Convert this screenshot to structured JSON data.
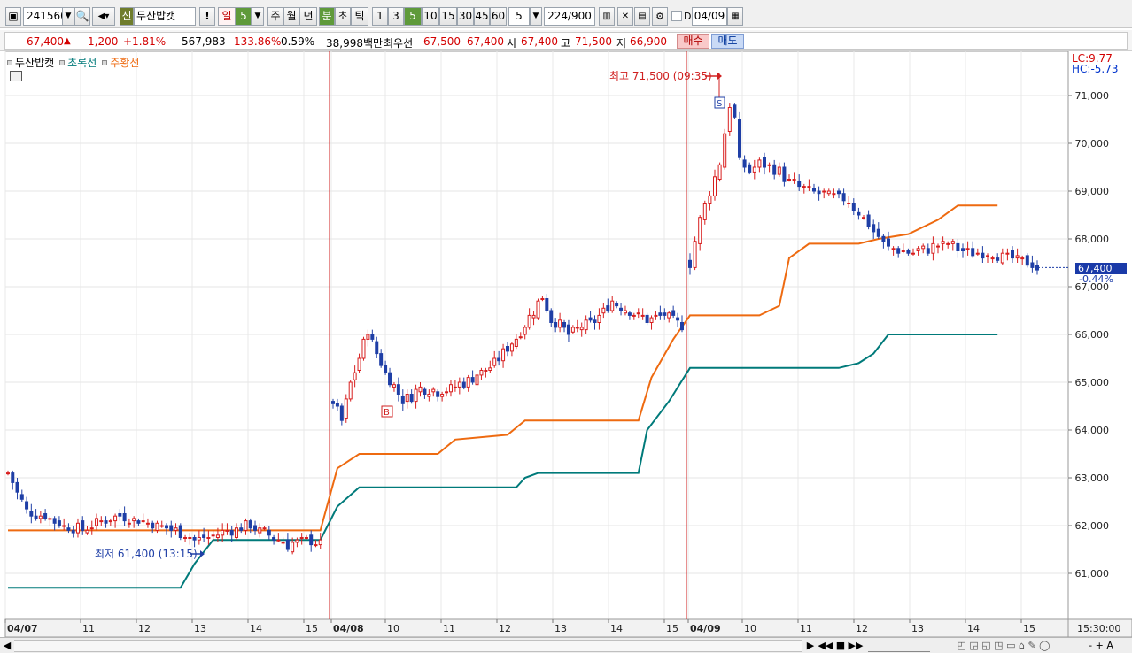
{
  "toolbar": {
    "code": "241560",
    "name": "두산밥캣",
    "credit_badge": "신",
    "alert": "!",
    "period_day": "일",
    "period_day_count": "5",
    "period_week": "주",
    "period_month": "월",
    "period_year": "년",
    "period_minute": "분",
    "period_second": "초",
    "period_tick": "틱",
    "minute_options": [
      "1",
      "3",
      "5",
      "10",
      "15",
      "30",
      "45",
      "60"
    ],
    "minute_selected": "5",
    "custom_interval": "5",
    "data_count": "224",
    "data_max": "/900",
    "d_label": "D",
    "date": "04/09"
  },
  "infobar": {
    "price": "67,400",
    "change": "1,200",
    "change_pct": "+1.81%",
    "volume": "567,983",
    "vol_ratio": "133.86%",
    "turnover": "0.59%",
    "amount": "38,998백만",
    "best_label": "최우선",
    "best_ask": "67,500",
    "best_bid": "67,400",
    "open_label": "시",
    "open": "67,400",
    "high_label": "고",
    "high": "71,500",
    "low_label": "저",
    "low": "66,900",
    "buy": "매수",
    "sell": "매도"
  },
  "legend": {
    "name": "두산밥캣",
    "green": "초록선",
    "orange": "주황선"
  },
  "lc": "LC:9.77",
  "hc": "HC:-5.73",
  "current_price": "67,400",
  "current_pct": "-0.44%",
  "annotations": {
    "high": "최고 71,500 (09:35)",
    "low": "최저 61,400 (13:15)",
    "buy_marker": "B",
    "sell_marker": "S"
  },
  "colors": {
    "up": "#d81e1e",
    "down": "#1f3fa6",
    "green_line": "#007a7a",
    "orange_line": "#ee6a10",
    "day_divider": "#d02020"
  },
  "chart_data": {
    "type": "candlestick",
    "interval": "5분",
    "ylim": [
      60500,
      71500
    ],
    "y_ticks": [
      61000,
      62000,
      63000,
      64000,
      65000,
      66000,
      67000,
      68000,
      69000,
      70000,
      71000
    ],
    "y_tick_labels": [
      "61,000",
      "62,000",
      "63,000",
      "64,000",
      "65,000",
      "66,000",
      "67,000",
      "68,000",
      "69,000",
      "70,000",
      "71,000"
    ],
    "x_labels": [
      "04/07",
      "11",
      "12",
      "13",
      "14",
      "15",
      "04/08",
      "10",
      "11",
      "12",
      "13",
      "14",
      "15",
      "04/09",
      "10",
      "11",
      "12",
      "13",
      "14",
      "15"
    ],
    "time_label": "15:30:00",
    "sessions": [
      {
        "date": "04/07",
        "close_points": [
          [
            0,
            63100
          ],
          [
            2,
            62700
          ],
          [
            4,
            62300
          ],
          [
            8,
            62200
          ],
          [
            12,
            62000
          ],
          [
            16,
            61900
          ],
          [
            20,
            62100
          ],
          [
            24,
            62200
          ],
          [
            28,
            62100
          ],
          [
            32,
            62000
          ],
          [
            36,
            61900
          ],
          [
            40,
            61700
          ],
          [
            44,
            61800
          ],
          [
            48,
            61900
          ],
          [
            52,
            62000
          ],
          [
            56,
            61800
          ],
          [
            60,
            61600
          ],
          [
            64,
            61700
          ],
          [
            67,
            61600
          ]
        ]
      },
      {
        "date": "04/08",
        "close_points": [
          [
            0,
            64600
          ],
          [
            2,
            64200
          ],
          [
            4,
            65000
          ],
          [
            6,
            65500
          ],
          [
            8,
            66100
          ],
          [
            10,
            65600
          ],
          [
            12,
            65200
          ],
          [
            14,
            64900
          ],
          [
            16,
            64600
          ],
          [
            18,
            64700
          ],
          [
            20,
            64900
          ],
          [
            24,
            64800
          ],
          [
            28,
            64900
          ],
          [
            32,
            65100
          ],
          [
            36,
            65300
          ],
          [
            40,
            65700
          ],
          [
            44,
            66200
          ],
          [
            48,
            66800
          ],
          [
            50,
            66300
          ],
          [
            52,
            66200
          ],
          [
            54,
            66000
          ],
          [
            56,
            66100
          ],
          [
            60,
            66300
          ],
          [
            64,
            66700
          ],
          [
            68,
            66500
          ],
          [
            72,
            66300
          ],
          [
            76,
            66400
          ],
          [
            80,
            66200
          ]
        ]
      },
      {
        "date": "04/09",
        "close_points": [
          [
            0,
            67500
          ],
          [
            2,
            68400
          ],
          [
            4,
            69000
          ],
          [
            6,
            69600
          ],
          [
            7,
            70200
          ],
          [
            8,
            70800
          ],
          [
            9,
            70500
          ],
          [
            10,
            69600
          ],
          [
            12,
            69400
          ],
          [
            14,
            69600
          ],
          [
            16,
            69500
          ],
          [
            18,
            69400
          ],
          [
            20,
            69200
          ],
          [
            24,
            69000
          ],
          [
            28,
            68900
          ],
          [
            32,
            68800
          ],
          [
            36,
            68300
          ],
          [
            40,
            67800
          ],
          [
            44,
            67700
          ],
          [
            48,
            67800
          ],
          [
            52,
            67900
          ],
          [
            56,
            67700
          ],
          [
            60,
            67700
          ],
          [
            64,
            67600
          ],
          [
            68,
            67500
          ],
          [
            70,
            67400
          ]
        ]
      }
    ],
    "series": [
      {
        "name": "초록선",
        "points": [
          [
            0,
            60700
          ],
          [
            37,
            60700
          ],
          [
            40,
            61200
          ],
          [
            44,
            61700
          ],
          [
            67,
            61700
          ],
          [
            69,
            62400
          ],
          [
            74,
            62800
          ],
          [
            100,
            62800
          ],
          [
            110,
            62800
          ],
          [
            112,
            63000
          ],
          [
            115,
            63100
          ],
          [
            138,
            63100
          ],
          [
            140,
            64000
          ],
          [
            145,
            64600
          ],
          [
            148,
            65300
          ],
          [
            178,
            65300
          ],
          [
            182,
            65400
          ],
          [
            185,
            65600
          ],
          [
            188,
            66000
          ],
          [
            210,
            66000
          ]
        ]
      },
      {
        "name": "주황선",
        "points": [
          [
            0,
            61900
          ],
          [
            67,
            61900
          ],
          [
            69,
            63200
          ],
          [
            74,
            63500
          ],
          [
            92,
            63500
          ],
          [
            96,
            63800
          ],
          [
            108,
            63900
          ],
          [
            112,
            64200
          ],
          [
            138,
            64200
          ],
          [
            141,
            65100
          ],
          [
            146,
            65900
          ],
          [
            148,
            66400
          ],
          [
            162,
            66400
          ],
          [
            166,
            66600
          ],
          [
            168,
            67600
          ],
          [
            172,
            67900
          ],
          [
            182,
            67900
          ],
          [
            186,
            68000
          ],
          [
            192,
            68100
          ],
          [
            198,
            68400
          ],
          [
            202,
            68700
          ],
          [
            210,
            68700
          ]
        ]
      }
    ]
  },
  "bottom": {
    "nav": "◀",
    "buttons": [
      "▶",
      "◀◀",
      "■",
      "▶▶"
    ],
    "zoom": "-  +  A"
  }
}
